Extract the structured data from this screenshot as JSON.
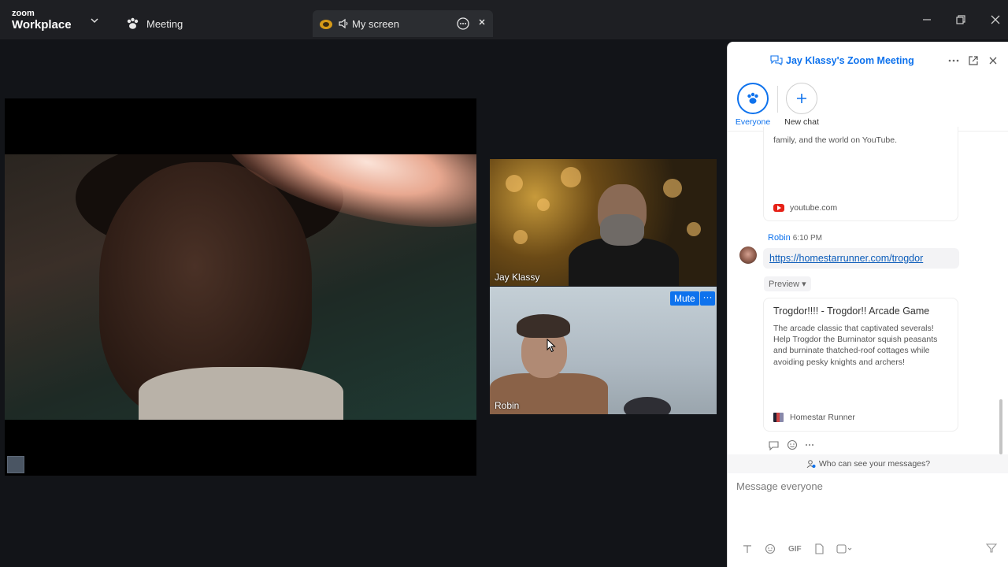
{
  "titlebar": {
    "logo_small": "zoom",
    "logo_big": "Workplace",
    "tab_meeting": "Meeting",
    "tab_screen": "My screen"
  },
  "stage": {},
  "participants": [
    {
      "name": "Jay Klassy"
    },
    {
      "name": "Robin",
      "mute_label": "Mute",
      "more_label": "···"
    }
  ],
  "chat": {
    "title": "Jay Klassy's Zoom Meeting",
    "recipients": [
      {
        "label": "Everyone",
        "icon": "everyone-paw-icon",
        "selected": true
      },
      {
        "label": "New chat",
        "icon": "plus-icon",
        "selected": false
      }
    ],
    "card1": {
      "desc": "family, and the world on YouTube.",
      "source": "youtube.com"
    },
    "message": {
      "sender": "Robin",
      "time": "6:10 PM",
      "link": "https://homestarrunner.com/trogdor",
      "preview_label": "Preview ▾"
    },
    "card2": {
      "title": "Trogdor!!!! - Trogdor!! Arcade Game",
      "desc": "The arcade classic that captivated severals! Help Trogdor the Burninator squish peasants and burninate thatched-roof cottages while avoiding pesky knights and archers!",
      "source": "Homestar Runner"
    },
    "who_can_see": "Who can see your messages?",
    "input_placeholder": "Message everyone",
    "toolbar_gif": "GIF"
  },
  "colors": {
    "accent": "#0e72ed",
    "titlebar_bg": "#1e1f23",
    "app_bg": "#121418"
  }
}
